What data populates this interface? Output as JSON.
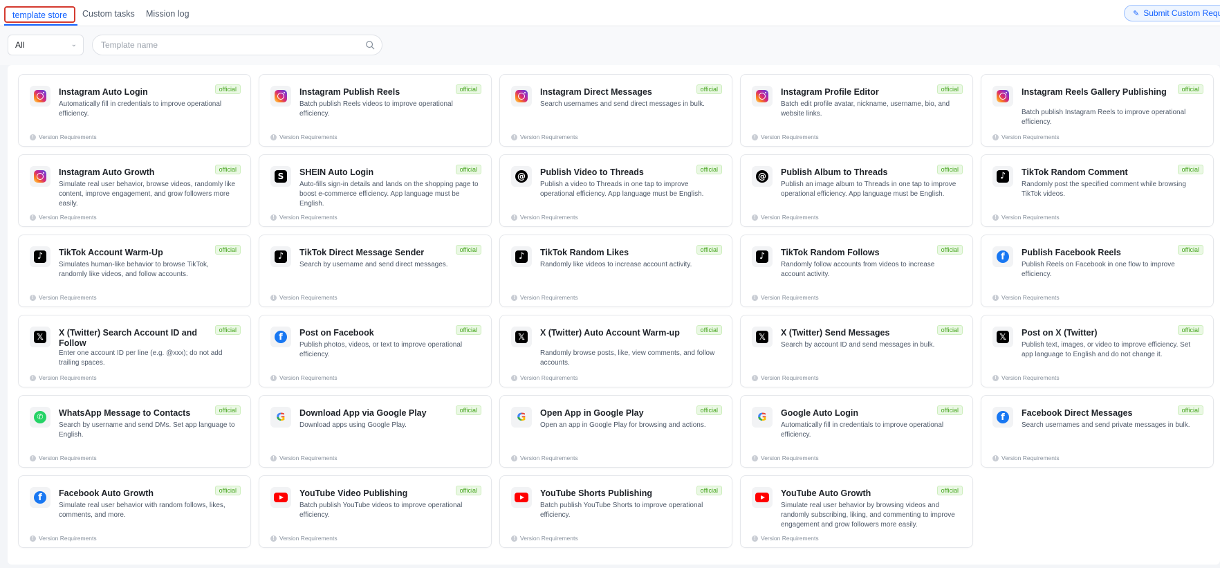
{
  "tabs": [
    {
      "label": "template store",
      "active": true
    },
    {
      "label": "Custom tasks",
      "active": false
    },
    {
      "label": "Mission log",
      "active": false
    }
  ],
  "submit_button": "Submit Custom Request",
  "filter": {
    "selected": "All"
  },
  "search": {
    "placeholder": "Template name"
  },
  "badge_label": "official",
  "version_label": "Version Requirements",
  "colors": {
    "accent": "#1664ff",
    "badge_bg": "#eaf8e4",
    "badge_text": "#47a51f",
    "tab_highlight": "#d43a2f"
  },
  "cards": [
    {
      "icon": "instagram-icon",
      "title": "Instagram Auto Login",
      "desc": "Automatically fill in credentials to improve operational efficiency."
    },
    {
      "icon": "instagram-icon",
      "title": "Instagram Publish Reels",
      "desc": "Batch publish Reels videos to improve operational efficiency."
    },
    {
      "icon": "instagram-icon",
      "title": "Instagram Direct Messages",
      "desc": "Search usernames and send direct messages in bulk."
    },
    {
      "icon": "instagram-icon",
      "title": "Instagram Profile Editor",
      "desc": "Batch edit profile avatar, nickname, username, bio, and website links."
    },
    {
      "icon": "instagram-icon",
      "title": "Instagram Reels Gallery Publishing",
      "desc": "Batch publish Instagram Reels to improve operational efficiency."
    },
    {
      "icon": "instagram-icon",
      "title": "Instagram Auto Growth",
      "desc": "Simulate real user behavior, browse videos, randomly like content, improve engagement, and grow followers more easily."
    },
    {
      "icon": "shein-icon",
      "title": "SHEIN Auto Login",
      "desc": "Auto-fills sign-in details and lands on the shopping page to boost e-commerce efficiency. App language must be English."
    },
    {
      "icon": "threads-icon",
      "title": "Publish Video to Threads",
      "desc": "Publish a video to Threads in one tap to improve operational efficiency. App language must be English."
    },
    {
      "icon": "threads-icon",
      "title": "Publish Album to Threads",
      "desc": "Publish an image album to Threads in one tap to improve operational efficiency. App language must be English."
    },
    {
      "icon": "tiktok-icon",
      "title": "TikTok Random Comment",
      "desc": "Randomly post the specified comment while browsing TikTok videos."
    },
    {
      "icon": "tiktok-icon",
      "title": "TikTok Account Warm-Up",
      "desc": "Simulates human-like behavior to browse TikTok, randomly like videos, and follow accounts."
    },
    {
      "icon": "tiktok-icon",
      "title": "TikTok Direct Message Sender",
      "desc": "Search by username and send direct messages."
    },
    {
      "icon": "tiktok-icon",
      "title": "TikTok Random Likes",
      "desc": "Randomly like videos to increase account activity."
    },
    {
      "icon": "tiktok-icon",
      "title": "TikTok Random Follows",
      "desc": "Randomly follow accounts from videos to increase account activity."
    },
    {
      "icon": "facebook-icon",
      "title": "Publish Facebook Reels",
      "desc": "Publish Reels on Facebook in one flow to improve efficiency."
    },
    {
      "icon": "x-icon",
      "title": "X (Twitter) Search Account ID and Follow",
      "desc": "Enter one account ID per line (e.g. @xxx); do not add trailing spaces."
    },
    {
      "icon": "facebook-icon",
      "title": "Post on Facebook",
      "desc": "Publish photos, videos, or text to improve operational efficiency."
    },
    {
      "icon": "x-icon",
      "title": "X (Twitter) Auto Account Warm-up",
      "desc": "Randomly browse posts, like, view comments, and follow accounts."
    },
    {
      "icon": "x-icon",
      "title": "X (Twitter) Send Messages",
      "desc": "Search by account ID and send messages in bulk."
    },
    {
      "icon": "x-icon",
      "title": "Post on X (Twitter)",
      "desc": "Publish text, images, or video to improve efficiency. Set app language to English and do not change it."
    },
    {
      "icon": "whatsapp-icon",
      "title": "WhatsApp Message to Contacts",
      "desc": "Search by username and send DMs. Set app language to English."
    },
    {
      "icon": "google-icon",
      "title": "Download App via Google Play",
      "desc": "Download apps using Google Play."
    },
    {
      "icon": "google-icon",
      "title": "Open App in Google Play",
      "desc": "Open an app in Google Play for browsing and actions."
    },
    {
      "icon": "google-icon",
      "title": "Google Auto Login",
      "desc": "Automatically fill in credentials to improve operational efficiency."
    },
    {
      "icon": "facebook-icon",
      "title": "Facebook Direct Messages",
      "desc": "Search usernames and send private messages in bulk."
    },
    {
      "icon": "facebook-icon",
      "title": "Facebook Auto Growth",
      "desc": "Simulate real user behavior with random follows, likes, comments, and more."
    },
    {
      "icon": "youtube-icon",
      "title": "YouTube Video Publishing",
      "desc": "Batch publish YouTube videos to improve operational efficiency."
    },
    {
      "icon": "youtube-icon",
      "title": "YouTube Shorts Publishing",
      "desc": "Batch publish YouTube Shorts to improve operational efficiency."
    },
    {
      "icon": "youtube-icon",
      "title": "YouTube Auto Growth",
      "desc": "Simulate real user behavior by browsing videos and randomly subscribing, liking, and commenting to improve engagement and grow followers more easily."
    }
  ]
}
